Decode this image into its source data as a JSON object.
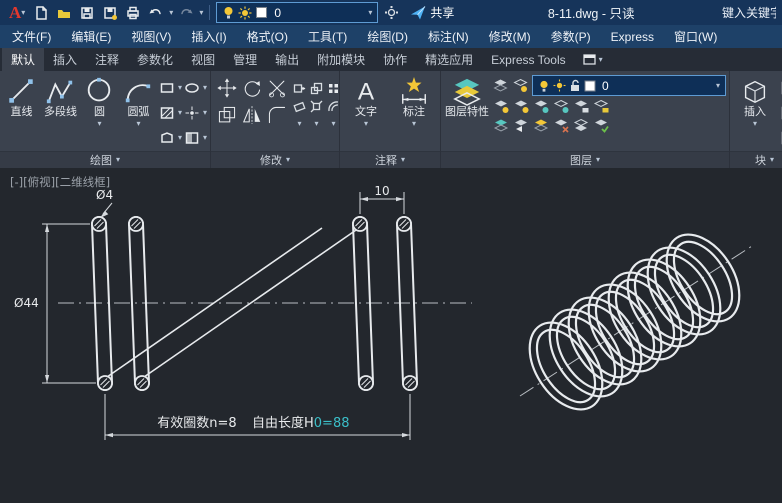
{
  "colors": {
    "titlebar": "#16345a",
    "menubar": "#1e4168",
    "tabrow": "#262c36",
    "ribbon": "#3b424e",
    "canvas": "#23272d",
    "line_white": "#e7eaed",
    "dim_cyan": "#3bbfc9",
    "icon_yellow": "#f3c737",
    "accent_blue": "#5e9bd3"
  },
  "icons": {
    "caret_down": "▾",
    "text_glyph": "A"
  },
  "titlebar": {
    "logo_letter": "A",
    "doc_title": "8-11.dwg - 只读",
    "share_label": "共享",
    "layer_combo_value": "0",
    "search_placeholder": "键入关键字"
  },
  "menubar": {
    "items": [
      "文件(F)",
      "编辑(E)",
      "视图(V)",
      "插入(I)",
      "格式(O)",
      "工具(T)",
      "绘图(D)",
      "标注(N)",
      "修改(M)",
      "参数(P)",
      "Express",
      "窗口(W)"
    ]
  },
  "ribbon": {
    "active_tab": "默认",
    "tabs": [
      "默认",
      "插入",
      "注释",
      "参数化",
      "视图",
      "管理",
      "输出",
      "附加模块",
      "协作",
      "精选应用",
      "Express Tools"
    ],
    "panels": {
      "draw": {
        "label": "绘图",
        "buttons": [
          "直线",
          "多段线",
          "圆",
          "圆弧"
        ]
      },
      "modify": {
        "label": "修改"
      },
      "annotation": {
        "label": "注释",
        "text_label": "文字",
        "dim_label": "标注"
      },
      "layers": {
        "label": "图层",
        "properties_label": "图层特性",
        "combo_value": "0"
      },
      "block": {
        "label": "块",
        "insert_label": "插入"
      }
    }
  },
  "canvas": {
    "viewport_label": "[-][俯视][二维线框]",
    "dims": {
      "wire": "Ø4",
      "pitch": "10",
      "outer": "Ø44",
      "coils_note": "有效圈数n=8",
      "free_prefix": "自由长度H",
      "free_suffix": "0=88"
    }
  }
}
